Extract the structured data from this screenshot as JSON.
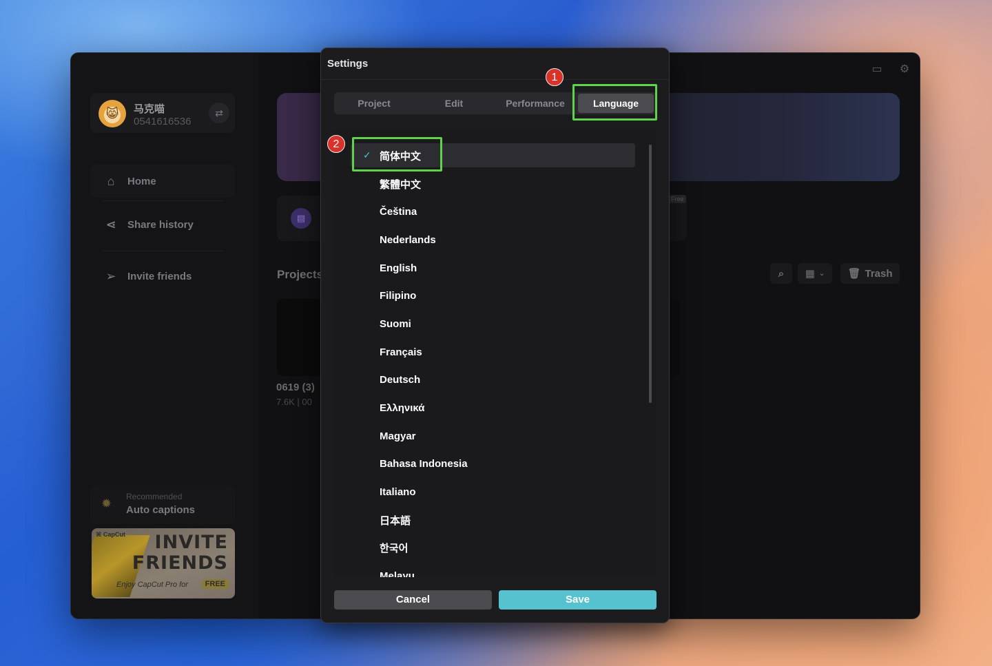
{
  "window": {
    "user": {
      "name": "马克喵",
      "id": "0541616536",
      "avatar_glyph": "😸"
    },
    "nav": [
      {
        "label": "Home",
        "icon": "home-icon",
        "glyph": "⌂"
      },
      {
        "label": "Share history",
        "icon": "share-icon",
        "glyph": "⋖"
      },
      {
        "label": "Invite friends",
        "icon": "send-icon",
        "glyph": "➢"
      }
    ],
    "recommended": {
      "small": "Recommended",
      "big": "Auto captions"
    },
    "invite_banner": {
      "brand": "⌘ CapCut",
      "title_line1": "INVITE",
      "title_line2": "FRIENDS",
      "sub": "Enjoy CapCut Pro for",
      "free": "FREE"
    },
    "main": {
      "free_tag": "Free",
      "projects_label": "Projects",
      "project": {
        "name": "0619 (3)",
        "meta": "7.6K | 00"
      },
      "trash_label": "Trash"
    }
  },
  "dialog": {
    "title": "Settings",
    "tabs": [
      "Project",
      "Edit",
      "Performance",
      "Language"
    ],
    "active_tab": "Language",
    "annotations": {
      "badge1": "1",
      "badge2": "2",
      "highlight_color": "#5fd34a",
      "badge_color": "#d9322a"
    },
    "languages": [
      "简体中文",
      "繁體中文",
      "Čeština",
      "Nederlands",
      "English",
      "Filipino",
      "Suomi",
      "Français",
      "Deutsch",
      "Ελληνικά",
      "Magyar",
      "Bahasa Indonesia",
      "Italiano",
      "日本語",
      "한국어",
      "Melayu"
    ],
    "selected_language": "简体中文",
    "cancel_label": "Cancel",
    "save_label": "Save",
    "accent_color": "#56c2d0"
  }
}
